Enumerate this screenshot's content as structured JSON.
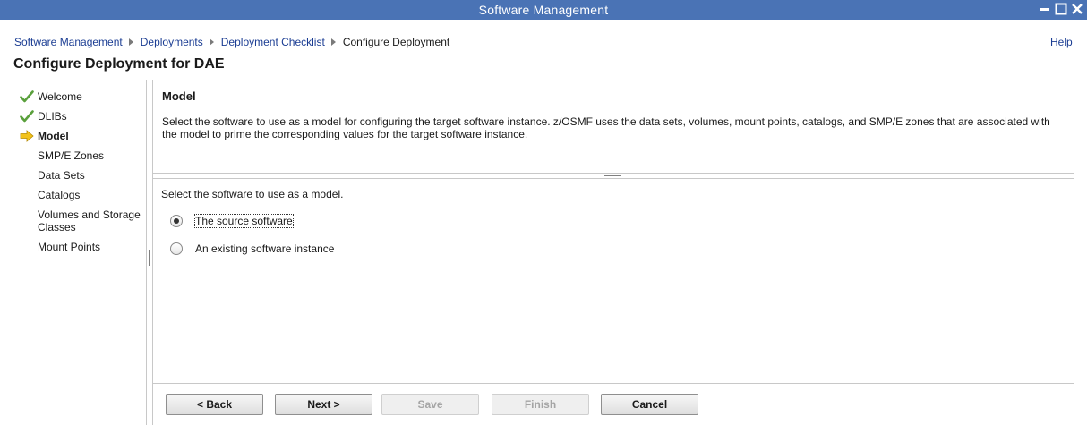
{
  "window": {
    "title": "Software Management",
    "controls": [
      "minimize-icon",
      "maximize-icon",
      "close-icon"
    ]
  },
  "breadcrumb": [
    {
      "label": "Software Management",
      "link": true
    },
    {
      "label": "Deployments",
      "link": true
    },
    {
      "label": "Deployment Checklist",
      "link": true
    },
    {
      "label": "Configure Deployment",
      "link": false
    }
  ],
  "help_label": "Help",
  "page_title": "Configure Deployment for DAE",
  "steps": [
    {
      "label": "Welcome",
      "status": "complete",
      "icon": "checkmark-icon"
    },
    {
      "label": "DLIBs",
      "status": "complete",
      "icon": "checkmark-icon"
    },
    {
      "label": "Model",
      "status": "current",
      "icon": "arrow-right-icon"
    },
    {
      "label": "SMP/E Zones",
      "status": "pending"
    },
    {
      "label": "Data Sets",
      "status": "pending"
    },
    {
      "label": "Catalogs",
      "status": "pending"
    },
    {
      "label": "Volumes and Storage Classes",
      "status": "pending"
    },
    {
      "label": "Mount Points",
      "status": "pending"
    }
  ],
  "section": {
    "title": "Model",
    "description": "Select the software to use as a model for configuring the target software instance.  z/OSMF uses the data sets, volumes, mount points, catalogs, and SMP/E zones that are associated with the model to prime the corresponding values for the target software instance."
  },
  "model_choice": {
    "prompt": "Select the software to use as a model.",
    "options": [
      {
        "label": "The source software",
        "selected": true
      },
      {
        "label": "An existing software instance",
        "selected": false
      }
    ]
  },
  "buttons": {
    "back": "< Back",
    "next": "Next >",
    "save": "Save",
    "finish": "Finish",
    "cancel": "Cancel"
  },
  "colors": {
    "titlebar": "#4a73b5",
    "link": "#1b3d93",
    "check": "#5aa03c",
    "current_arrow": "#f2c21a"
  }
}
